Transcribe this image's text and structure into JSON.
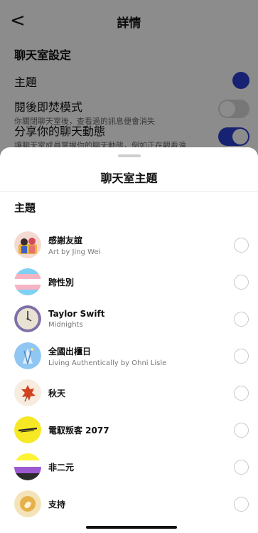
{
  "background": {
    "back_glyph": "<",
    "header_title": "詳情",
    "section_title": "聊天室設定",
    "rows": [
      {
        "title": "主題",
        "subtitle": ""
      },
      {
        "title": "閱後即焚模式",
        "subtitle": "你關閉聊天室後，查看過的訊息便會消失"
      },
      {
        "title": "分享你的聊天動態",
        "subtitle": "讓聊天室成員掌握你的聊天動態，例如正在觀看遠"
      }
    ],
    "theme_color": "#2d3fd0",
    "toggle_off_color": "#d9d9d9",
    "toggle_on_color": "#2d3fd0"
  },
  "sheet": {
    "title": "聊天室主題",
    "section_title": "主題",
    "items": [
      {
        "name": "感謝友誼",
        "subtitle": "Art by Jing Wei",
        "icon": "friendship-art-icon"
      },
      {
        "name": "跨性別",
        "subtitle": "",
        "icon": "transgender-flag-icon"
      },
      {
        "name": "Taylor Swift",
        "subtitle": "Midnights",
        "icon": "clock-icon"
      },
      {
        "name": "全國出櫃日",
        "subtitle": "Living Authentically by Ohni Lisle",
        "icon": "coming-out-art-icon"
      },
      {
        "name": "秋天",
        "subtitle": "",
        "icon": "autumn-leaf-icon"
      },
      {
        "name": "電馭叛客 2077",
        "subtitle": "",
        "icon": "cyberpunk-logo-icon"
      },
      {
        "name": "非二元",
        "subtitle": "",
        "icon": "nonbinary-flag-icon"
      },
      {
        "name": "支持",
        "subtitle": "",
        "icon": "support-icon"
      }
    ]
  }
}
